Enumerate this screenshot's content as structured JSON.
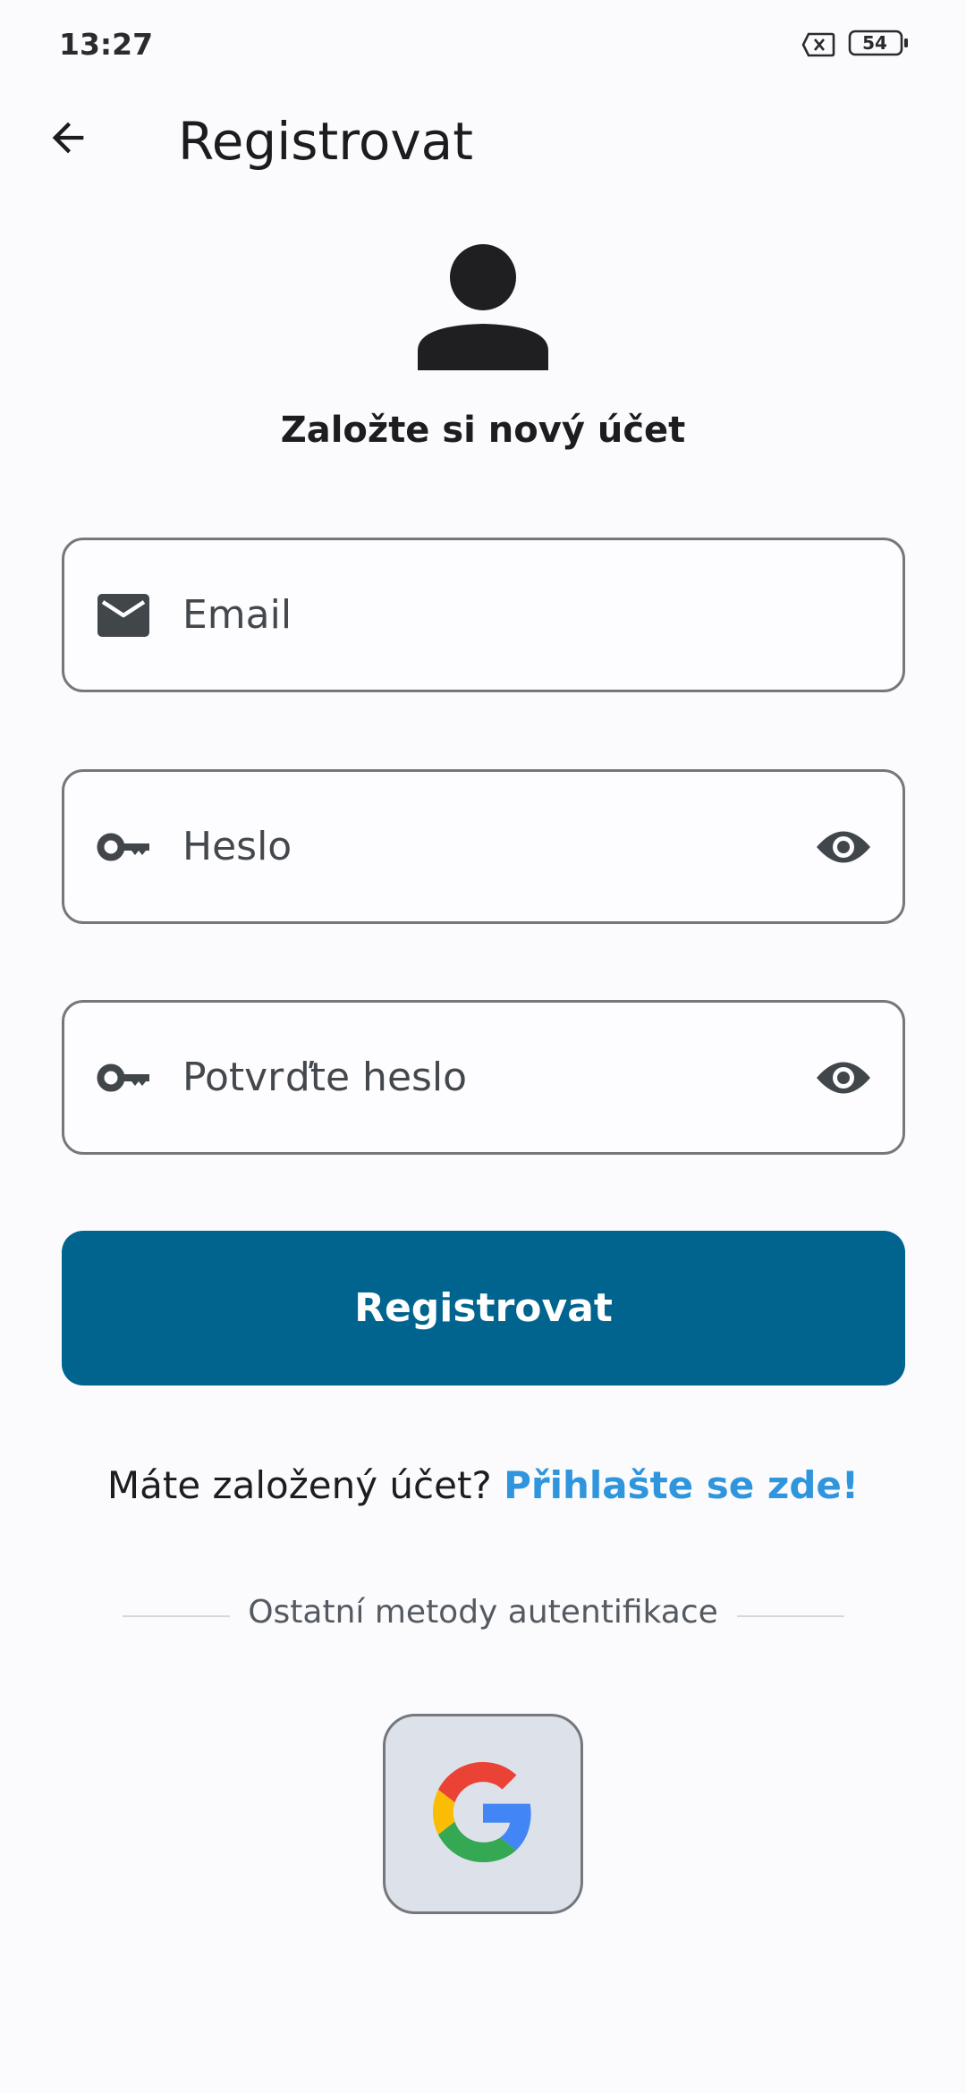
{
  "status_bar": {
    "time": "13:27",
    "battery_level": "54",
    "icons": [
      "no-sim-icon",
      "battery-icon"
    ]
  },
  "app_bar": {
    "title": "Registrovat",
    "back_icon": "arrow-back-icon"
  },
  "header": {
    "avatar_icon": "person-icon",
    "subtitle": "Založte si nový účet"
  },
  "form": {
    "email": {
      "placeholder": "Email",
      "value": "",
      "icon": "mail-icon"
    },
    "password": {
      "placeholder": "Heslo",
      "value": "",
      "icon": "key-icon",
      "toggle_icon": "eye-icon"
    },
    "confirm_password": {
      "placeholder": "Potvrďte heslo",
      "value": "",
      "icon": "key-icon",
      "toggle_icon": "eye-icon"
    },
    "submit_label": "Registrovat"
  },
  "login_prompt": {
    "text": "Máte založený účet? ",
    "link": "Přihlašte se zde!"
  },
  "alt_auth": {
    "label": "Ostatní metody autentifikace",
    "providers": [
      {
        "name": "google",
        "icon": "google-icon"
      }
    ]
  },
  "colors": {
    "primary": "#00648f",
    "link": "#2f95dc",
    "background": "#fbfbfe",
    "outline": "#74777b",
    "google_tile": "#dde2ea"
  }
}
